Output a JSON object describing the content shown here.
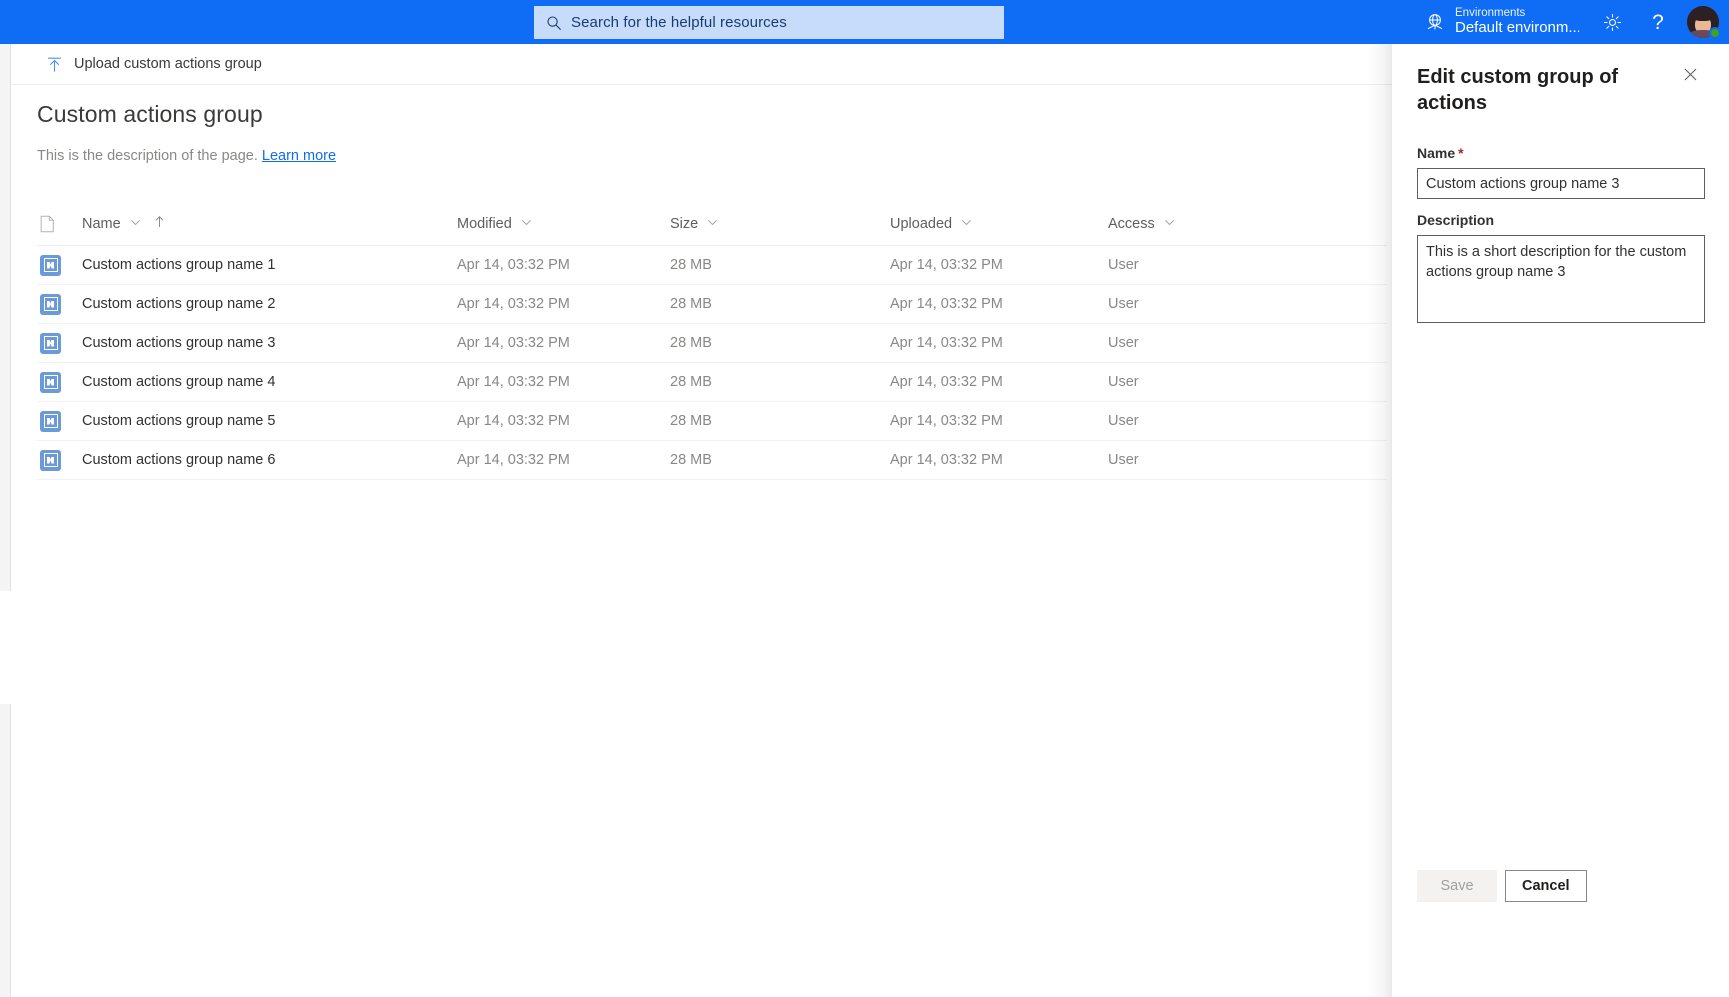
{
  "suite": {
    "search": {
      "placeholder": "Search for the helpful resources",
      "icon": "search-icon"
    },
    "environment": {
      "label": "Environments",
      "value": "Default environm...",
      "icon": "environment-globe-icon"
    },
    "settings_icon": "gear-icon",
    "help_icon": "question-mark-icon",
    "avatar": "user-avatar",
    "brand_color": "#0f6cf5",
    "search_bg": "#c7dcfb"
  },
  "command_bar": {
    "upload_label": "Upload custom actions group",
    "upload_icon": "upload-icon"
  },
  "page": {
    "title": "Custom actions group",
    "description": "This is the description of the page.",
    "learn_more": "Learn more"
  },
  "table": {
    "columns": [
      {
        "key": "icon",
        "label": "",
        "sortable": false,
        "sorted": false
      },
      {
        "key": "name",
        "label": "Name",
        "sortable": true,
        "sorted": true,
        "sort_dir": "asc"
      },
      {
        "key": "modified",
        "label": "Modified",
        "sortable": true,
        "sorted": false
      },
      {
        "key": "size",
        "label": "Size",
        "sortable": true,
        "sorted": false
      },
      {
        "key": "uploaded",
        "label": "Uploaded",
        "sortable": true,
        "sorted": false
      },
      {
        "key": "access",
        "label": "Access",
        "sortable": true,
        "sorted": false
      }
    ],
    "rows": [
      {
        "icon": "custom-action-tile-icon",
        "name": "Custom actions group name 1",
        "modified": "Apr 14, 03:32 PM",
        "size": "28 MB",
        "uploaded": "Apr 14, 03:32 PM",
        "access": "User"
      },
      {
        "icon": "custom-action-tile-icon",
        "name": "Custom actions group name 2",
        "modified": "Apr 14, 03:32 PM",
        "size": "28 MB",
        "uploaded": "Apr 14, 03:32 PM",
        "access": "User"
      },
      {
        "icon": "custom-action-tile-icon",
        "name": "Custom actions group name 3",
        "modified": "Apr 14, 03:32 PM",
        "size": "28 MB",
        "uploaded": "Apr 14, 03:32 PM",
        "access": "User"
      },
      {
        "icon": "custom-action-tile-icon",
        "name": "Custom actions group name 4",
        "modified": "Apr 14, 03:32 PM",
        "size": "28 MB",
        "uploaded": "Apr 14, 03:32 PM",
        "access": "User"
      },
      {
        "icon": "custom-action-tile-icon",
        "name": "Custom actions group name 5",
        "modified": "Apr 14, 03:32 PM",
        "size": "28 MB",
        "uploaded": "Apr 14, 03:32 PM",
        "access": "User"
      },
      {
        "icon": "custom-action-tile-icon",
        "name": "Custom actions group name 6",
        "modified": "Apr 14, 03:32 PM",
        "size": "28 MB",
        "uploaded": "Apr 14, 03:32 PM",
        "access": "User"
      }
    ]
  },
  "panel": {
    "title": "Edit custom group of actions",
    "close_icon": "close-icon",
    "name_label": "Name",
    "name_required_mark": "*",
    "name_value": "Custom actions group name 3",
    "description_label": "Description",
    "description_value": "This is a short description for the custom actions group name 3",
    "save_label": "Save",
    "save_disabled": true,
    "cancel_label": "Cancel"
  }
}
